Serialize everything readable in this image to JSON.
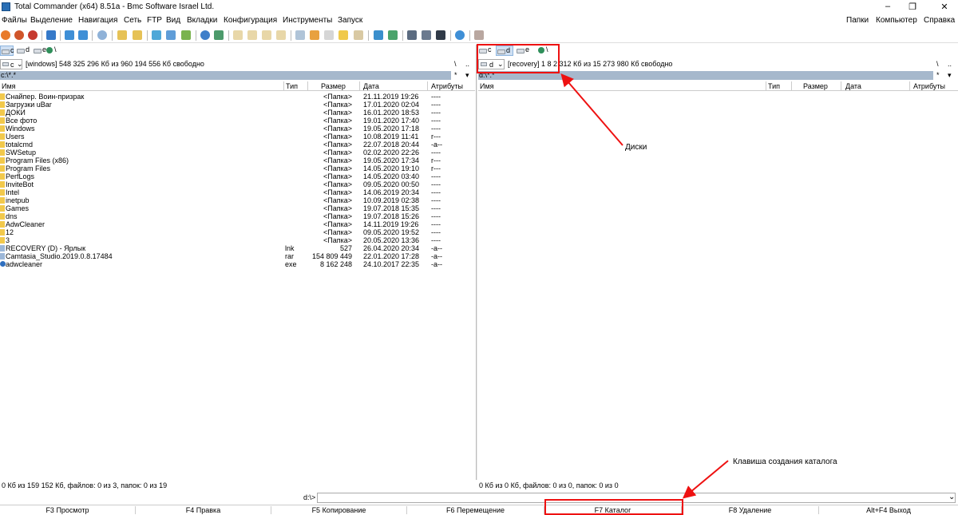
{
  "window": {
    "title": "Total Commander (x64) 8.51a - Bmc Software Israel Ltd.",
    "controls": [
      "–",
      "❐",
      "✕"
    ]
  },
  "menu": {
    "left": [
      "Файлы",
      "Выделение",
      "Навигация",
      "Сеть",
      "FTP",
      "Вид",
      "Вкладки",
      "Конфигурация",
      "Инструменты",
      "Запуск"
    ],
    "right": [
      "Папки",
      "Компьютер",
      "Справка"
    ]
  },
  "left_panel": {
    "drives": [
      "c",
      "d",
      "e"
    ],
    "root_label": "\\",
    "selected_drive": "c",
    "info": "[windows]  548 325 296 Кб из 960 194 556 Кб свободно",
    "nav_root": "\\",
    "nav_up": "..",
    "nav_star": "*",
    "nav_arrow": "▾",
    "path": "c:\\*.*",
    "columns": [
      "Имя",
      "Тип",
      "Размер",
      "Дата",
      "Атрибуты"
    ],
    "rows": [
      {
        "name": "Снайпер. Воин-призрак",
        "ext": "",
        "size": "<Папка>",
        "date": "21.11.2019 19:26",
        "attr": "----",
        "kind": "folder"
      },
      {
        "name": "Загрузки uBar",
        "ext": "",
        "size": "<Папка>",
        "date": "17.01.2020 02:04",
        "attr": "----",
        "kind": "folder"
      },
      {
        "name": "ДОКИ",
        "ext": "",
        "size": "<Папка>",
        "date": "16.01.2020 18:53",
        "attr": "----",
        "kind": "folder"
      },
      {
        "name": "Все фото",
        "ext": "",
        "size": "<Папка>",
        "date": "19.01.2020 17:40",
        "attr": "----",
        "kind": "folder"
      },
      {
        "name": "Windows",
        "ext": "",
        "size": "<Папка>",
        "date": "19.05.2020 17:18",
        "attr": "----",
        "kind": "folder"
      },
      {
        "name": "Users",
        "ext": "",
        "size": "<Папка>",
        "date": "10.08.2019 11:41",
        "attr": "r---",
        "kind": "folder"
      },
      {
        "name": "totalcmd",
        "ext": "",
        "size": "<Папка>",
        "date": "22.07.2018 20:44",
        "attr": "-a--",
        "kind": "folder"
      },
      {
        "name": "SWSetup",
        "ext": "",
        "size": "<Папка>",
        "date": "02.02.2020 22:26",
        "attr": "----",
        "kind": "folder"
      },
      {
        "name": "Program Files (x86)",
        "ext": "",
        "size": "<Папка>",
        "date": "19.05.2020 17:34",
        "attr": "r---",
        "kind": "folder"
      },
      {
        "name": "Program Files",
        "ext": "",
        "size": "<Папка>",
        "date": "14.05.2020 19:10",
        "attr": "r---",
        "kind": "folder"
      },
      {
        "name": "PerfLogs",
        "ext": "",
        "size": "<Папка>",
        "date": "14.05.2020 03:40",
        "attr": "----",
        "kind": "folder"
      },
      {
        "name": "InviteBot",
        "ext": "",
        "size": "<Папка>",
        "date": "09.05.2020 00:50",
        "attr": "----",
        "kind": "folder"
      },
      {
        "name": "Intel",
        "ext": "",
        "size": "<Папка>",
        "date": "14.06.2019 20:34",
        "attr": "----",
        "kind": "folder"
      },
      {
        "name": "inetpub",
        "ext": "",
        "size": "<Папка>",
        "date": "10.09.2019 02:38",
        "attr": "----",
        "kind": "folder"
      },
      {
        "name": "Games",
        "ext": "",
        "size": "<Папка>",
        "date": "19.07.2018 15:35",
        "attr": "----",
        "kind": "folder"
      },
      {
        "name": "dns",
        "ext": "",
        "size": "<Папка>",
        "date": "19.07.2018 15:26",
        "attr": "----",
        "kind": "folder"
      },
      {
        "name": "AdwCleaner",
        "ext": "",
        "size": "<Папка>",
        "date": "14.11.2019 19:26",
        "attr": "----",
        "kind": "folder"
      },
      {
        "name": "12",
        "ext": "",
        "size": "<Папка>",
        "date": "09.05.2020 19:52",
        "attr": "----",
        "kind": "folder"
      },
      {
        "name": "3",
        "ext": "",
        "size": "<Папка>",
        "date": "20.05.2020 13:36",
        "attr": "----",
        "kind": "folder"
      },
      {
        "name": "RECOVERY (D) - Ярлык",
        "ext": "lnk",
        "size": "527",
        "date": "26.04.2020 20:34",
        "attr": "-a--",
        "kind": "file"
      },
      {
        "name": "Camtasia_Studio.2019.0.8.17484",
        "ext": "rar",
        "size": "154 809 449",
        "date": "22.01.2020 17:28",
        "attr": "-a--",
        "kind": "file"
      },
      {
        "name": "adwcleaner",
        "ext": "exe",
        "size": "8 162 248",
        "date": "24.10.2017 22:35",
        "attr": "-a--",
        "kind": "exe"
      }
    ],
    "status": "0 Кб из 159 152 Кб, файлов: 0 из 3, папок: 0 из 19"
  },
  "right_panel": {
    "drives": [
      "c",
      "d",
      "e"
    ],
    "root_label": "\\",
    "selected_drive": "d",
    "info": "[recovery]  1 8 2 312 Кб из 15 273 980 Кб свободно",
    "nav_root": "\\",
    "nav_up": "..",
    "nav_star": "*",
    "nav_arrow": "▾",
    "path": "d:\\*.*",
    "columns": [
      "Имя",
      "Тип",
      "Размер",
      "Дата",
      "Атрибуты"
    ],
    "status": "0 Кб из 0 Кб, файлов: 0 из 0, папок: 0 из 0"
  },
  "command_line": {
    "prompt": "d:\\>",
    "value": ""
  },
  "fkeys": [
    "F3 Просмотр",
    "F4 Правка",
    "F5 Копирование",
    "F6 Перемещение",
    "F7 Каталог",
    "F8 Удаление",
    "Alt+F4 Выход"
  ],
  "annotations": {
    "drives_label": "Диски",
    "mkdir_label": "Клавиша создания каталога"
  },
  "colors": {
    "path_bar": "#a6b8cc",
    "annotation_red": "#e11111",
    "folder": "#f2c94c"
  }
}
